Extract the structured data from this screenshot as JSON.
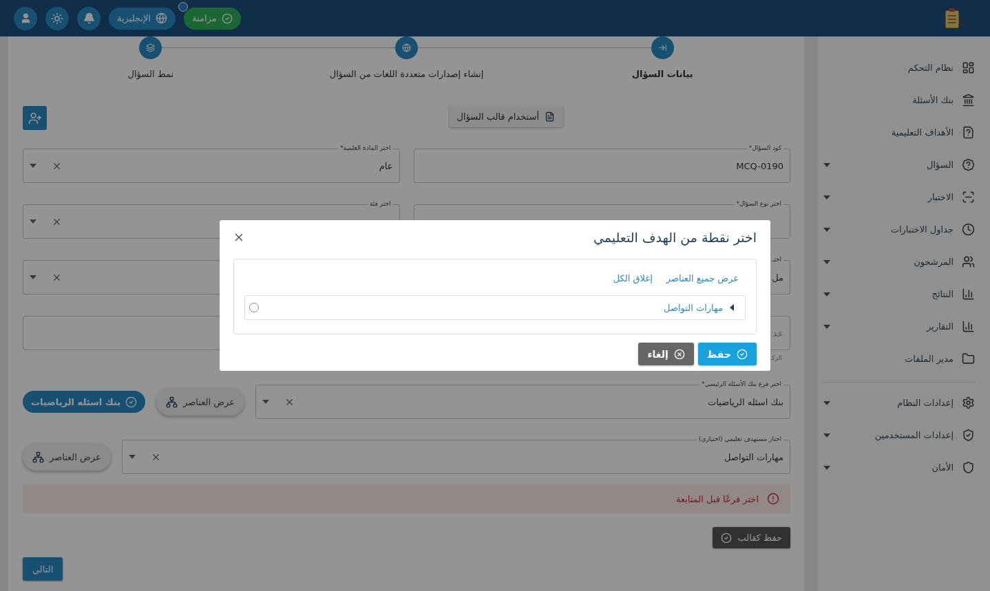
{
  "header": {
    "sync_button": {
      "label": "مزامنة"
    },
    "language_button": {
      "label": "الإنجليزية"
    }
  },
  "stepper": [
    {
      "label": "بيانات السؤال",
      "selected": true
    },
    {
      "label": "إنشاء إصدارات متعددة اللغات من السؤال",
      "selected": false
    },
    {
      "label": "نمط السؤال",
      "selected": false
    }
  ],
  "template_button": "أستخدام قالب السؤال",
  "form_rows": [
    {
      "right": {
        "kind": "text",
        "label": "كود السؤال*",
        "value": "MCQ-0190"
      },
      "left": {
        "kind": "select",
        "label": "اختر المادة العلمية*",
        "value": "عام"
      }
    },
    {
      "right": {
        "kind": "text",
        "label": "اختر نوع السؤال*"
      },
      "left": {
        "kind": "select",
        "label": "اختر فئة"
      }
    },
    {
      "right": {
        "kind": "text",
        "label": "اختـ",
        "value": "مل"
      },
      "left": {
        "kind": "select"
      }
    },
    {
      "right": {
        "kind": "text",
        "placeholder": "عد",
        "helper": "الركـ"
      },
      "left": {
        "kind": "text"
      }
    }
  ],
  "branch_row": {
    "field": {
      "kind": "select",
      "label": "اختر فرع بنك الأسئلة الرئيسي*",
      "value": "بنك اسئله الرياضيات"
    },
    "view_button": "عرض العناصر",
    "chip": "بنك اسئله الرياضيات"
  },
  "objective_row": {
    "field": {
      "kind": "select",
      "label": "اختار مستهدف تعليمي (اختياري)",
      "value": "مهارات التواصل"
    },
    "view_button": "عرض العناصر"
  },
  "alert": "اختر فرعًا قبل المتابعة",
  "save_template_button": "حفظ كقالب",
  "next_button": "التالي",
  "sidebar": {
    "groups": [
      [
        {
          "label": "نظام التحكم",
          "expandable": false
        },
        {
          "label": "بنك الأسئلة",
          "expandable": false
        },
        {
          "label": "الأهداف التعليمية",
          "expandable": false
        },
        {
          "label": "السؤال",
          "expandable": true
        },
        {
          "label": "الاختبار",
          "expandable": true
        },
        {
          "label": "جداول الاختبارات",
          "expandable": true
        },
        {
          "label": "المرشحون",
          "expandable": true
        },
        {
          "label": "النتائج",
          "expandable": true
        },
        {
          "label": "التقارير",
          "expandable": true
        },
        {
          "label": "مدير الملفات",
          "expandable": false
        }
      ],
      [
        {
          "label": "إعدادات النظام",
          "expandable": true
        },
        {
          "label": "إعدادات المستخدمين",
          "expandable": true
        },
        {
          "label": "الأمان",
          "expandable": true
        }
      ]
    ]
  },
  "dialog": {
    "title": "اختر نقطة من الهدف التعليمي",
    "expand_all_link": "عرض جميع العناصر",
    "collapse_all_link": "إغلاق الكل",
    "tree": [
      {
        "label": "مهارات التواصل",
        "expanded": false,
        "selected": false
      }
    ],
    "buttons": [
      {
        "label": "حفظ",
        "kind": "primary"
      },
      {
        "label": "إلغاء",
        "kind": "cancel"
      }
    ]
  }
}
